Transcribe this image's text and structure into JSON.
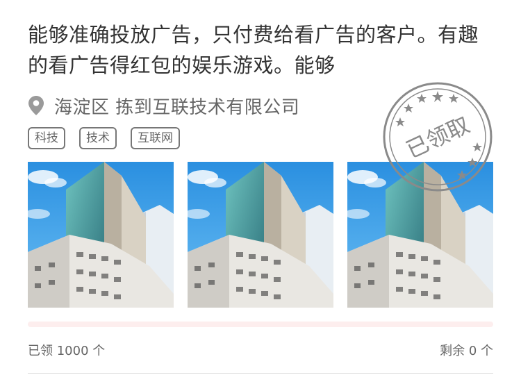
{
  "card": {
    "title": "能够准确投放广告，只付费给看广告的客户。有趣的看广告得红包的娱乐游戏。能够",
    "location_icon": "location-pin-icon",
    "location": "海淀区 拣到互联技术有限公司",
    "tags": [
      "科技",
      "技术",
      "互联网"
    ],
    "photos": [
      {
        "alt": "office-building-photo"
      },
      {
        "alt": "office-building-photo"
      },
      {
        "alt": "office-building-photo"
      }
    ],
    "progress": {
      "claimed_fraction": 1.0,
      "track_color": "#fdeeee"
    },
    "claimed_text": "已领 1000 个",
    "remaining_text": "剩余 0 个",
    "stamp_text": "已领取"
  }
}
